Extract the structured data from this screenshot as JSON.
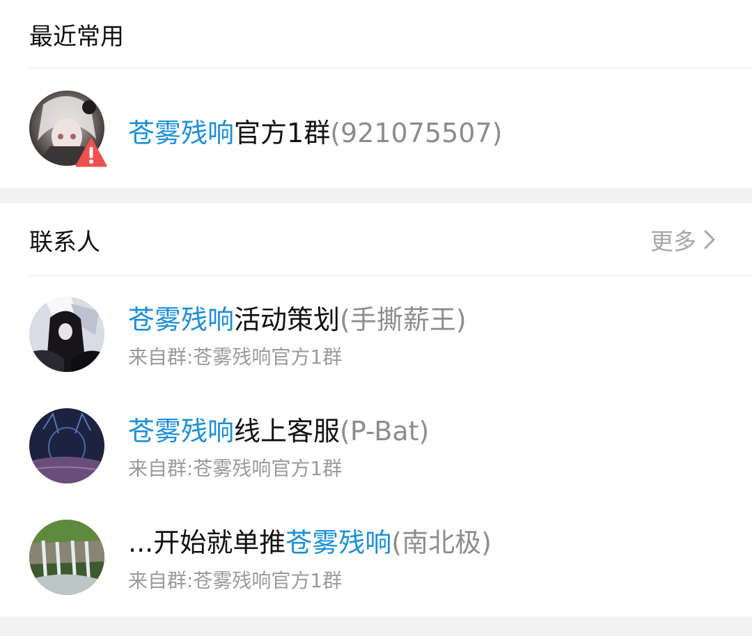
{
  "recent": {
    "title": "最近常用",
    "item": {
      "name_highlight": "苍雾残响",
      "name_rest": "官方1群",
      "paren": "(921075507)"
    }
  },
  "contacts": {
    "title": "联系人",
    "more_label": "更多",
    "items": [
      {
        "name_prefix": "",
        "name_highlight": "苍雾残响",
        "name_rest": "活动策划",
        "paren": "(手撕薪王)",
        "sub": "来自群:苍雾残响官方1群"
      },
      {
        "name_prefix": "",
        "name_highlight": "苍雾残响",
        "name_rest": "线上客服",
        "paren": "(P-Bat)",
        "sub": "来自群:苍雾残响官方1群"
      },
      {
        "name_prefix": "...开始就单推",
        "name_highlight": "苍雾残响",
        "name_rest": "",
        "paren": "(南北极)",
        "sub": "来自群:苍雾残响官方1群"
      }
    ]
  },
  "colors": {
    "highlight": "#1a8fd8",
    "warning": "#f0504f"
  }
}
